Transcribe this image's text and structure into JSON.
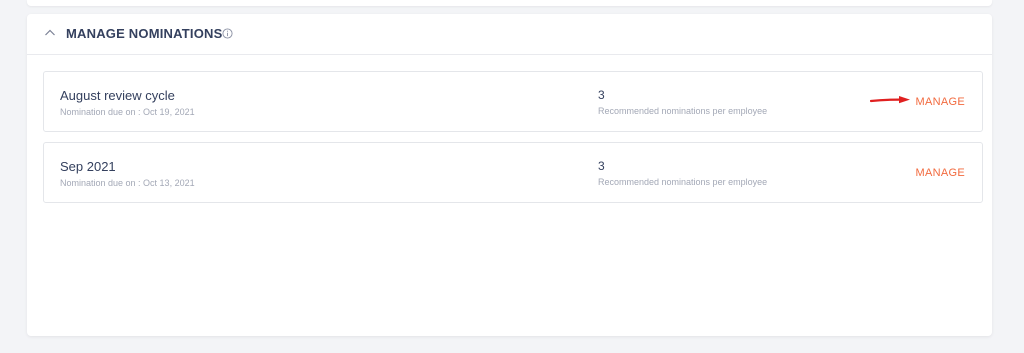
{
  "header": {
    "title": "MANAGE NOMINATIONS",
    "collapse_icon": "chevron-up-icon",
    "info_icon": "info-circle-icon"
  },
  "nominations": [
    {
      "name": "August review cycle",
      "due": "Nomination due on : Oct 19, 2021",
      "count": "3",
      "count_label": "Recommended nominations per employee",
      "action": "MANAGE"
    },
    {
      "name": "Sep 2021",
      "due": "Nomination due on : Oct 13, 2021",
      "count": "3",
      "count_label": "Recommended nominations per employee",
      "action": "MANAGE"
    }
  ],
  "colors": {
    "accent": "#f26a3e",
    "annotation_arrow": "#e02020",
    "title": "#34405e",
    "muted": "#a3a8b6"
  }
}
